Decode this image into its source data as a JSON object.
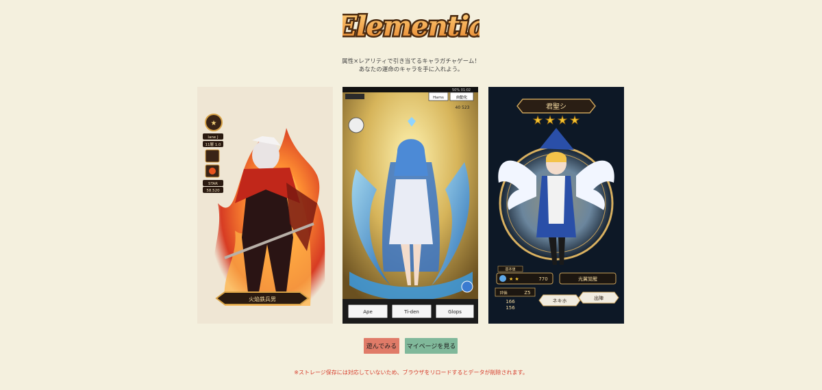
{
  "logo": {
    "text": "Elementia"
  },
  "tagline": {
    "line1": "属性×レアリティで引き当てるキャラガチャゲーム！",
    "line2": "あなたの運命のキャラを手に入れよう。"
  },
  "cards": [
    {
      "element": "fire",
      "side_labels": [
        "lane J",
        "11層 1.0",
        "STAR",
        "58.520"
      ],
      "name_plate": "火焔鉄兵男"
    },
    {
      "element": "water",
      "status_bar": "50% 01:02",
      "top_tabs": [
        "Hams",
        "自動化"
      ],
      "counter": "40 523",
      "bottom_buttons": [
        "Ape",
        "Ti-den",
        "Glops"
      ]
    },
    {
      "element": "light",
      "title": "君聖シ",
      "stars": 4,
      "stat_label": "基本値",
      "stat_value": "770",
      "skill_label": "光翼覚醒",
      "level_label": "評価",
      "level_value": "Z5",
      "stat_lines": [
        "166",
        "156"
      ],
      "btn_left": "ネキホ",
      "btn_right": "出陣"
    }
  ],
  "actions": {
    "play_label": "遊んでみる",
    "mypage_label": "マイページを見る"
  },
  "warning": "※ストレージ保存には対応していないため、ブラウザをリロードするとデータが削除されます。",
  "colors": {
    "background": "#f4f0de",
    "play_button": "#e07b68",
    "mypage_button": "#80b89a",
    "warning_text": "#d63a2a",
    "logo_fill": "#f3a24a"
  }
}
